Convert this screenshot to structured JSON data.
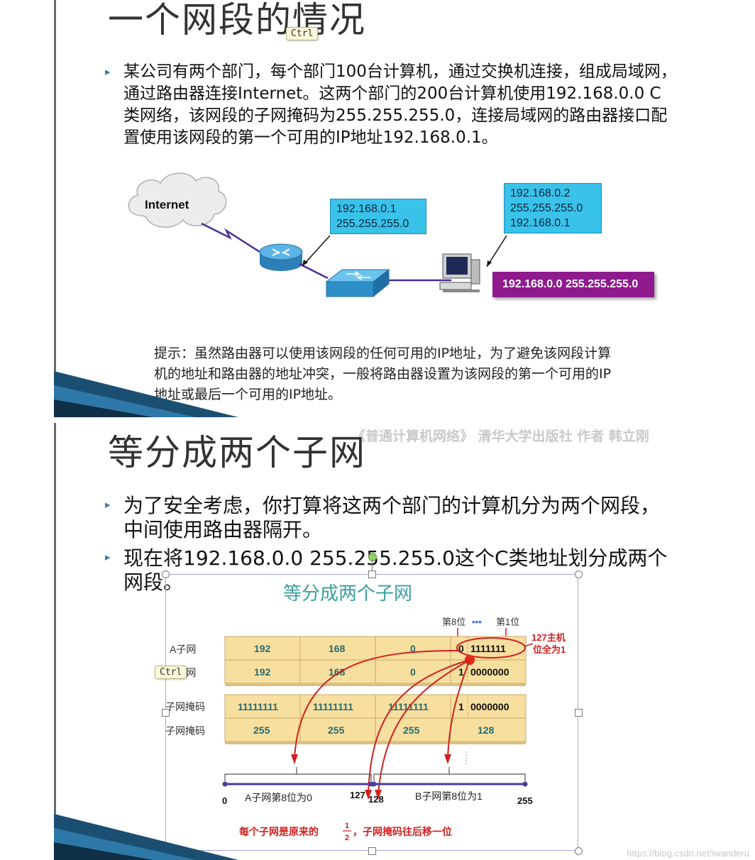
{
  "slide1": {
    "title": "一个网段的情况",
    "bullet": "某公司有两个部门，每个部门100台计算机，通过交换机连接，组成局域网，通过路由器连接Internet。这两个部门的200台计算机使用192.168.0.0 C类网络，该网段的子网掩码为255.255.255.0，连接局域网的路由器接口配置使用该网段的第一个可用的IP地址192.168.0.1。",
    "diagram": {
      "cloud_label": "Internet",
      "router_box": [
        "192.168.0.1",
        "255.255.255.0"
      ],
      "pc_box": [
        "192.168.0.2",
        "255.255.255.0",
        "192.168.0.1"
      ],
      "network_box": "192.168.0.0 255.255.255.0"
    },
    "tip": "提示：虽然路由器可以使用该网段的任何可用的IP地址，为了避免该网段计算机的地址和路由器的地址冲突，一般将路由器设置为该网段的第一个可用的IP地址或最后一个可用的IP地址。",
    "ctrl_tooltip": "Ctrl"
  },
  "slide2": {
    "title": "等分成两个子网",
    "watermark": "《普通计算机网络》 清华大学出版社 作者 韩立刚",
    "bullets": [
      "为了安全考虑，你打算将这两个部门的计算机分为两个网段，中间使用路由器隔开。",
      "现在将192.168.0.0 255.255.255.0这个C类地址划分成两个网段。"
    ],
    "ctrl_tooltip": "Ctrl",
    "figure": {
      "title": "等分成两个子网",
      "bit_labels": [
        "第8位",
        "•••",
        "第1位"
      ],
      "host_note": [
        "127主机",
        "位全为1"
      ],
      "rows": [
        {
          "label": "A子网",
          "cells": [
            "192",
            "168",
            "0",
            "0",
            "1111111"
          ]
        },
        {
          "label": "B子网",
          "cells": [
            "192",
            "168",
            "0",
            "1",
            "0000000"
          ]
        },
        {
          "label": "子网掩码",
          "cells": [
            "11111111",
            "11111111",
            "11111111",
            "1",
            "0000000"
          ]
        },
        {
          "label": "子网掩码",
          "cells": [
            "255",
            "255",
            "255",
            "128",
            ""
          ]
        }
      ],
      "range": {
        "start": "0",
        "a_end": "127",
        "b_start": "128",
        "end": "255",
        "a_label": "A子网第8位为0",
        "b_label": "B子网第8位为1"
      },
      "caption_before": "每个子网是原来的",
      "caption_fraction": [
        "1",
        "2"
      ],
      "caption_after": "，子网掩码往后移一位"
    }
  },
  "page_watermark": "https://blog.csdn.net/iwanderu",
  "colors": {
    "bullet": "#3a7db5",
    "ip_box": "#39c2ea",
    "network_box": "#8e1a8d",
    "table_cell": "#f7dfa0",
    "figure_title": "#3aa0a0",
    "annotation_red": "#d22020",
    "range_line": "#4a3a9a"
  }
}
